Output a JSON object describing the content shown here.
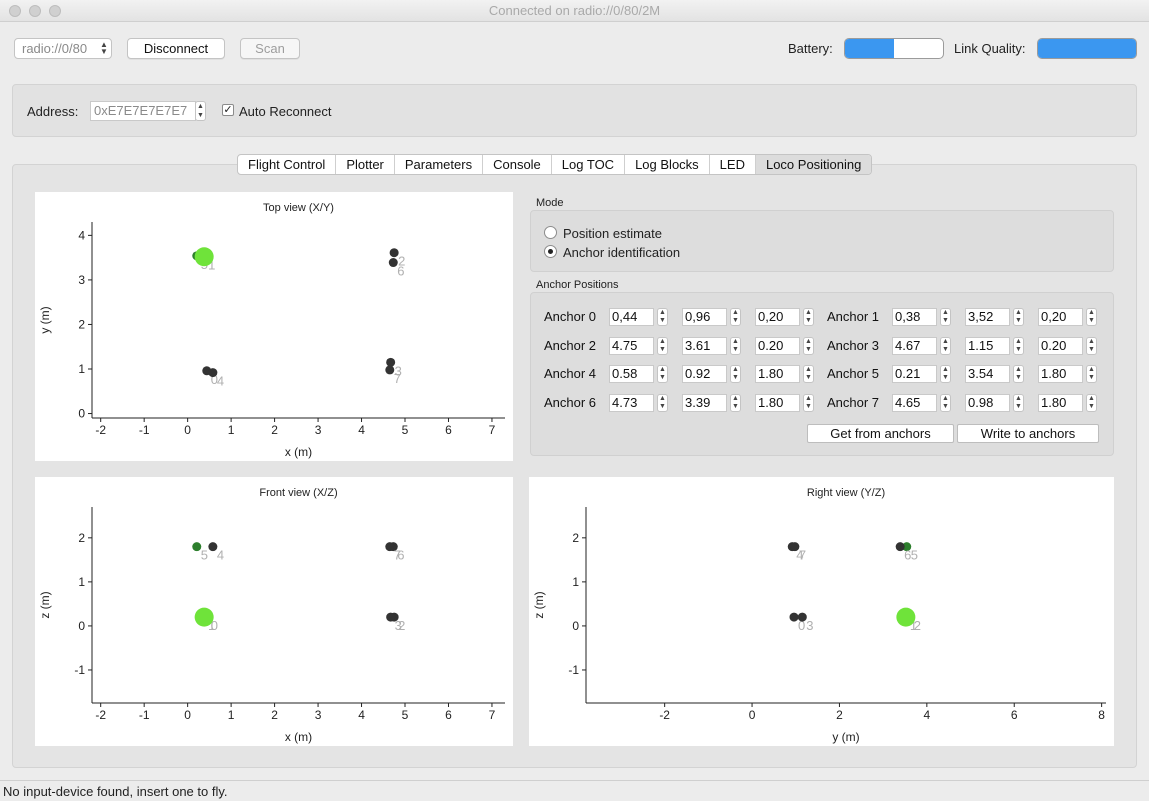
{
  "window": {
    "title": "Connected on radio://0/80/2M"
  },
  "toolbar": {
    "uri_value": "radio://0/80",
    "disconnect_label": "Disconnect",
    "scan_label": "Scan",
    "battery_label": "Battery:",
    "battery_level": 0.5,
    "link_label": "Link Quality:",
    "link_level": 1.0
  },
  "address": {
    "label": "Address:",
    "value": "0xE7E7E7E7E7",
    "auto_reconnect_label": "Auto Reconnect",
    "auto_reconnect_checked": true
  },
  "tabs": [
    "Flight Control",
    "Plotter",
    "Parameters",
    "Console",
    "Log TOC",
    "Log Blocks",
    "LED",
    "Loco Positioning"
  ],
  "active_tab": "Loco Positioning",
  "mode": {
    "title": "Mode",
    "options": [
      "Position estimate",
      "Anchor identification"
    ],
    "selected": 1
  },
  "anchors": {
    "title": "Anchor Positions",
    "get_label": "Get from anchors",
    "write_label": "Write to anchors",
    "items": [
      {
        "label": "Anchor 0",
        "x": "0,44",
        "y": "0,96",
        "z": "0,20"
      },
      {
        "label": "Anchor 1",
        "x": "0,38",
        "y": "3,52",
        "z": "0,20"
      },
      {
        "label": "Anchor 2",
        "x": "4.75",
        "y": "3.61",
        "z": "0.20"
      },
      {
        "label": "Anchor 3",
        "x": "4.67",
        "y": "1.15",
        "z": "0.20"
      },
      {
        "label": "Anchor 4",
        "x": "0.58",
        "y": "0.92",
        "z": "1.80"
      },
      {
        "label": "Anchor 5",
        "x": "0.21",
        "y": "3.54",
        "z": "1.80"
      },
      {
        "label": "Anchor 6",
        "x": "4.73",
        "y": "3.39",
        "z": "1.80"
      },
      {
        "label": "Anchor 7",
        "x": "4.65",
        "y": "0.98",
        "z": "1.80"
      }
    ]
  },
  "chart_data": [
    {
      "type": "scatter",
      "title": "Top view (X/Y)",
      "xlabel": "x (m)",
      "ylabel": "y (m)",
      "xlim": [
        -2.2,
        7.3
      ],
      "ylim": [
        -0.1,
        4.3
      ],
      "xticks": [
        -2,
        -1,
        0,
        1,
        2,
        3,
        4,
        5,
        6,
        7
      ],
      "yticks": [
        0,
        1,
        2,
        3,
        4
      ],
      "points": [
        {
          "label": "0",
          "x": 0.44,
          "y": 0.96
        },
        {
          "label": "1",
          "x": 0.38,
          "y": 3.52
        },
        {
          "label": "2",
          "x": 4.75,
          "y": 3.61
        },
        {
          "label": "3",
          "x": 4.67,
          "y": 1.15
        },
        {
          "label": "4",
          "x": 0.58,
          "y": 0.92
        },
        {
          "label": "5",
          "x": 0.21,
          "y": 3.54
        },
        {
          "label": "6",
          "x": 4.73,
          "y": 3.39
        },
        {
          "label": "7",
          "x": 4.65,
          "y": 0.98
        }
      ],
      "highlight": {
        "x": 0.38,
        "y": 3.52
      }
    },
    {
      "type": "scatter",
      "title": "Front view (X/Z)",
      "xlabel": "x (m)",
      "ylabel": "z (m)",
      "xlim": [
        -2.2,
        7.3
      ],
      "ylim": [
        -1.75,
        2.7
      ],
      "xticks": [
        -2,
        -1,
        0,
        1,
        2,
        3,
        4,
        5,
        6,
        7
      ],
      "yticks": [
        -1,
        0,
        1,
        2
      ],
      "points": [
        {
          "label": "0",
          "x": 0.44,
          "y": 0.2
        },
        {
          "label": "1",
          "x": 0.38,
          "y": 0.2
        },
        {
          "label": "2",
          "x": 4.75,
          "y": 0.2
        },
        {
          "label": "3",
          "x": 4.67,
          "y": 0.2
        },
        {
          "label": "4",
          "x": 0.58,
          "y": 1.8
        },
        {
          "label": "5",
          "x": 0.21,
          "y": 1.8
        },
        {
          "label": "6",
          "x": 4.73,
          "y": 1.8
        },
        {
          "label": "7",
          "x": 4.65,
          "y": 1.8
        }
      ],
      "highlight": {
        "x": 0.38,
        "y": 0.2
      }
    },
    {
      "type": "scatter",
      "title": "Right view (Y/Z)",
      "xlabel": "y (m)",
      "ylabel": "z (m)",
      "xlim": [
        -3.8,
        8.1
      ],
      "ylim": [
        -1.75,
        2.7
      ],
      "xticks": [
        -2,
        0,
        2,
        4,
        6,
        8
      ],
      "yticks": [
        -1,
        0,
        1,
        2
      ],
      "points": [
        {
          "label": "0",
          "x": 0.96,
          "y": 0.2
        },
        {
          "label": "1",
          "x": 3.52,
          "y": 0.2
        },
        {
          "label": "2",
          "x": 3.61,
          "y": 0.2
        },
        {
          "label": "3",
          "x": 1.15,
          "y": 0.2
        },
        {
          "label": "4",
          "x": 0.92,
          "y": 1.8
        },
        {
          "label": "5",
          "x": 3.54,
          "y": 1.8
        },
        {
          "label": "6",
          "x": 3.39,
          "y": 1.8
        },
        {
          "label": "7",
          "x": 0.98,
          "y": 1.8
        }
      ],
      "highlight": {
        "x": 3.52,
        "y": 0.2
      }
    }
  ],
  "colors": {
    "accent": "#3b97f0",
    "highlight": "#6fe33a",
    "anchor_dark": "#333333",
    "anchor_green": "#2d7f2d",
    "label_gray": "#b0b0b0"
  },
  "status": "No input-device found, insert one to fly."
}
